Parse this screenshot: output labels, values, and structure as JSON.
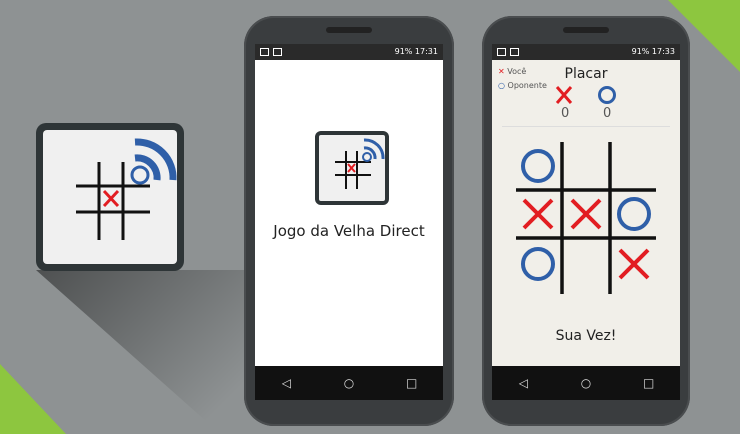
{
  "splash": {
    "title": "Jogo da Velha Direct"
  },
  "phone1_status": {
    "right": "91% 17:31"
  },
  "phone2_status": {
    "right": "91% 17:33"
  },
  "game": {
    "legend_you": "Você",
    "legend_opponent": "Oponente",
    "score_title": "Placar",
    "score_x": "0",
    "score_o": "0",
    "turn_message": "Sua Vez!",
    "board": [
      "O",
      "",
      "",
      "X",
      "X",
      "O",
      "O",
      "",
      "X"
    ]
  },
  "nav": {
    "back": "◁",
    "home": "○",
    "recent": "□"
  },
  "colors": {
    "x": "#e21d22",
    "o": "#2f5fa8",
    "accent": "#8dc63f"
  }
}
